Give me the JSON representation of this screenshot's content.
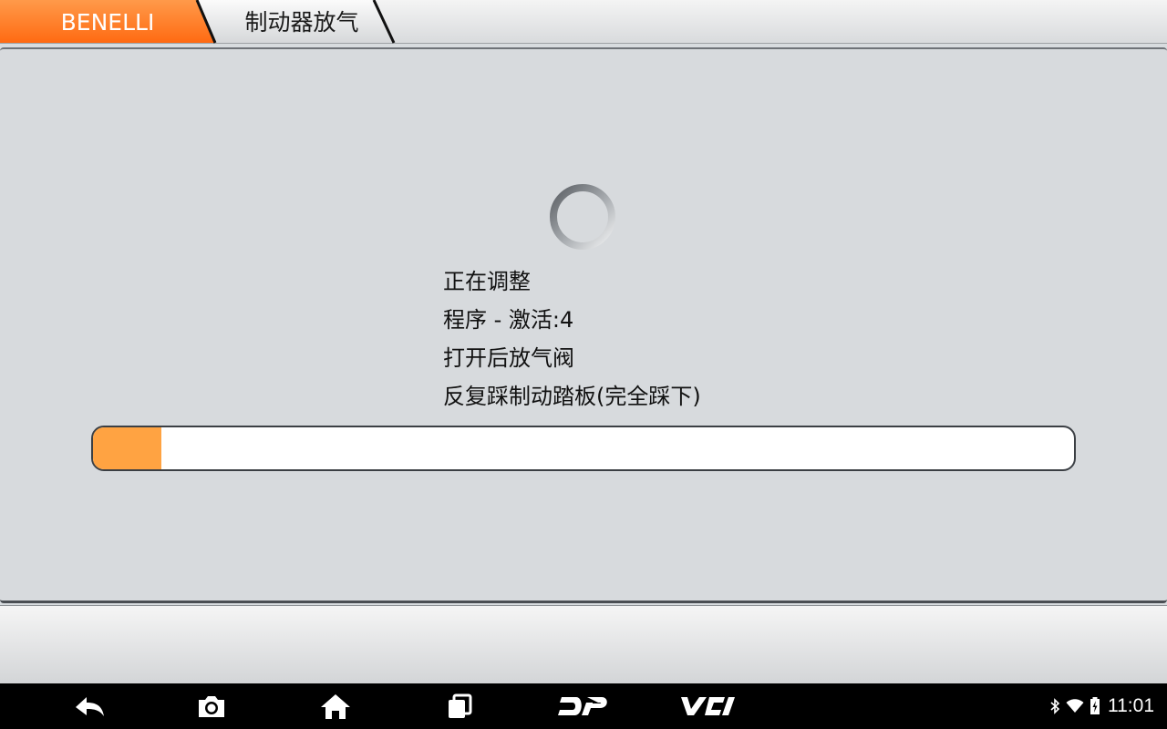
{
  "breadcrumb": {
    "brand": "BENELLI",
    "page": "制动器放气"
  },
  "status": {
    "lines": [
      "正在调整",
      "程序 - 激活:4",
      "打开后放气阀",
      "反复踩制动踏板(完全踩下)"
    ],
    "progress_fraction": 0.07
  },
  "nav": {
    "dp_label": "DP",
    "vci_label": "VCI"
  },
  "system": {
    "time": "11:01"
  },
  "colors": {
    "accent_orange": "#ff7a1a",
    "progress_orange": "#ffa342",
    "panel_gray": "#d7dadd"
  },
  "icons": {
    "back": "back-icon",
    "screenshot": "camera-icon",
    "home": "home-icon",
    "recents": "recents-icon",
    "bluetooth": "bluetooth-icon",
    "wifi": "wifi-icon",
    "battery": "battery-charging-icon"
  }
}
